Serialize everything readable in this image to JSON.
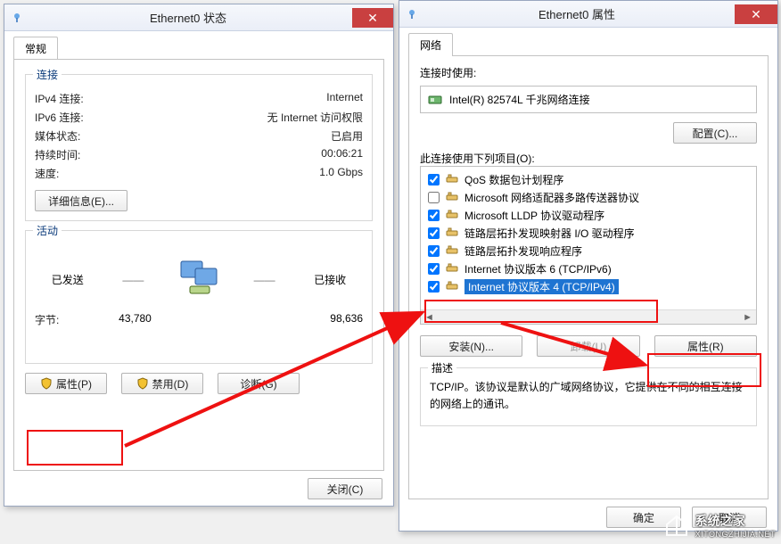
{
  "status_window": {
    "title": "Ethernet0 状态",
    "tab": "常规",
    "connection": {
      "legend": "连接",
      "ipv4_label": "IPv4 连接:",
      "ipv4_value": "Internet",
      "ipv6_label": "IPv6 连接:",
      "ipv6_value": "无 Internet 访问权限",
      "media_label": "媒体状态:",
      "media_value": "已启用",
      "dur_label": "持续时间:",
      "dur_value": "00:06:21",
      "speed_label": "速度:",
      "speed_value": "1.0 Gbps",
      "details_btn": "详细信息(E)..."
    },
    "activity": {
      "legend": "活动",
      "sent": "已发送",
      "recv": "已接收",
      "bytes_label": "字节:",
      "bytes_sent": "43,780",
      "bytes_recv": "98,636"
    },
    "buttons": {
      "props": "属性(P)",
      "disable": "禁用(D)",
      "diag": "诊断(G)",
      "close": "关闭(C)"
    }
  },
  "props_window": {
    "title": "Ethernet0 属性",
    "tab": "网络",
    "connect_using_label": "连接时使用:",
    "adapter": "Intel(R) 82574L 千兆网络连接",
    "configure_btn": "配置(C)...",
    "items_label": "此连接使用下列项目(O):",
    "items": [
      {
        "checked": true,
        "label": "QoS 数据包计划程序"
      },
      {
        "checked": false,
        "label": "Microsoft 网络适配器多路传送器协议"
      },
      {
        "checked": true,
        "label": "Microsoft LLDP 协议驱动程序"
      },
      {
        "checked": true,
        "label": "链路层拓扑发现映射器 I/O 驱动程序"
      },
      {
        "checked": true,
        "label": "链路层拓扑发现响应程序"
      },
      {
        "checked": true,
        "label": "Internet 协议版本 6 (TCP/IPv6)"
      },
      {
        "checked": true,
        "label": "Internet 协议版本 4 (TCP/IPv4)",
        "selected": true
      }
    ],
    "install_btn": "安装(N)...",
    "uninstall_btn": "卸载(U)",
    "item_props_btn": "属性(R)",
    "desc_legend": "描述",
    "desc_text": "TCP/IP。该协议是默认的广域网络协议，它提供在不同的相互连接的网络上的通讯。",
    "ok_btn": "确定",
    "cancel_btn": "取消"
  },
  "watermark": {
    "site": "系统之家",
    "sub": "XITONGZHIJIA.NET"
  }
}
